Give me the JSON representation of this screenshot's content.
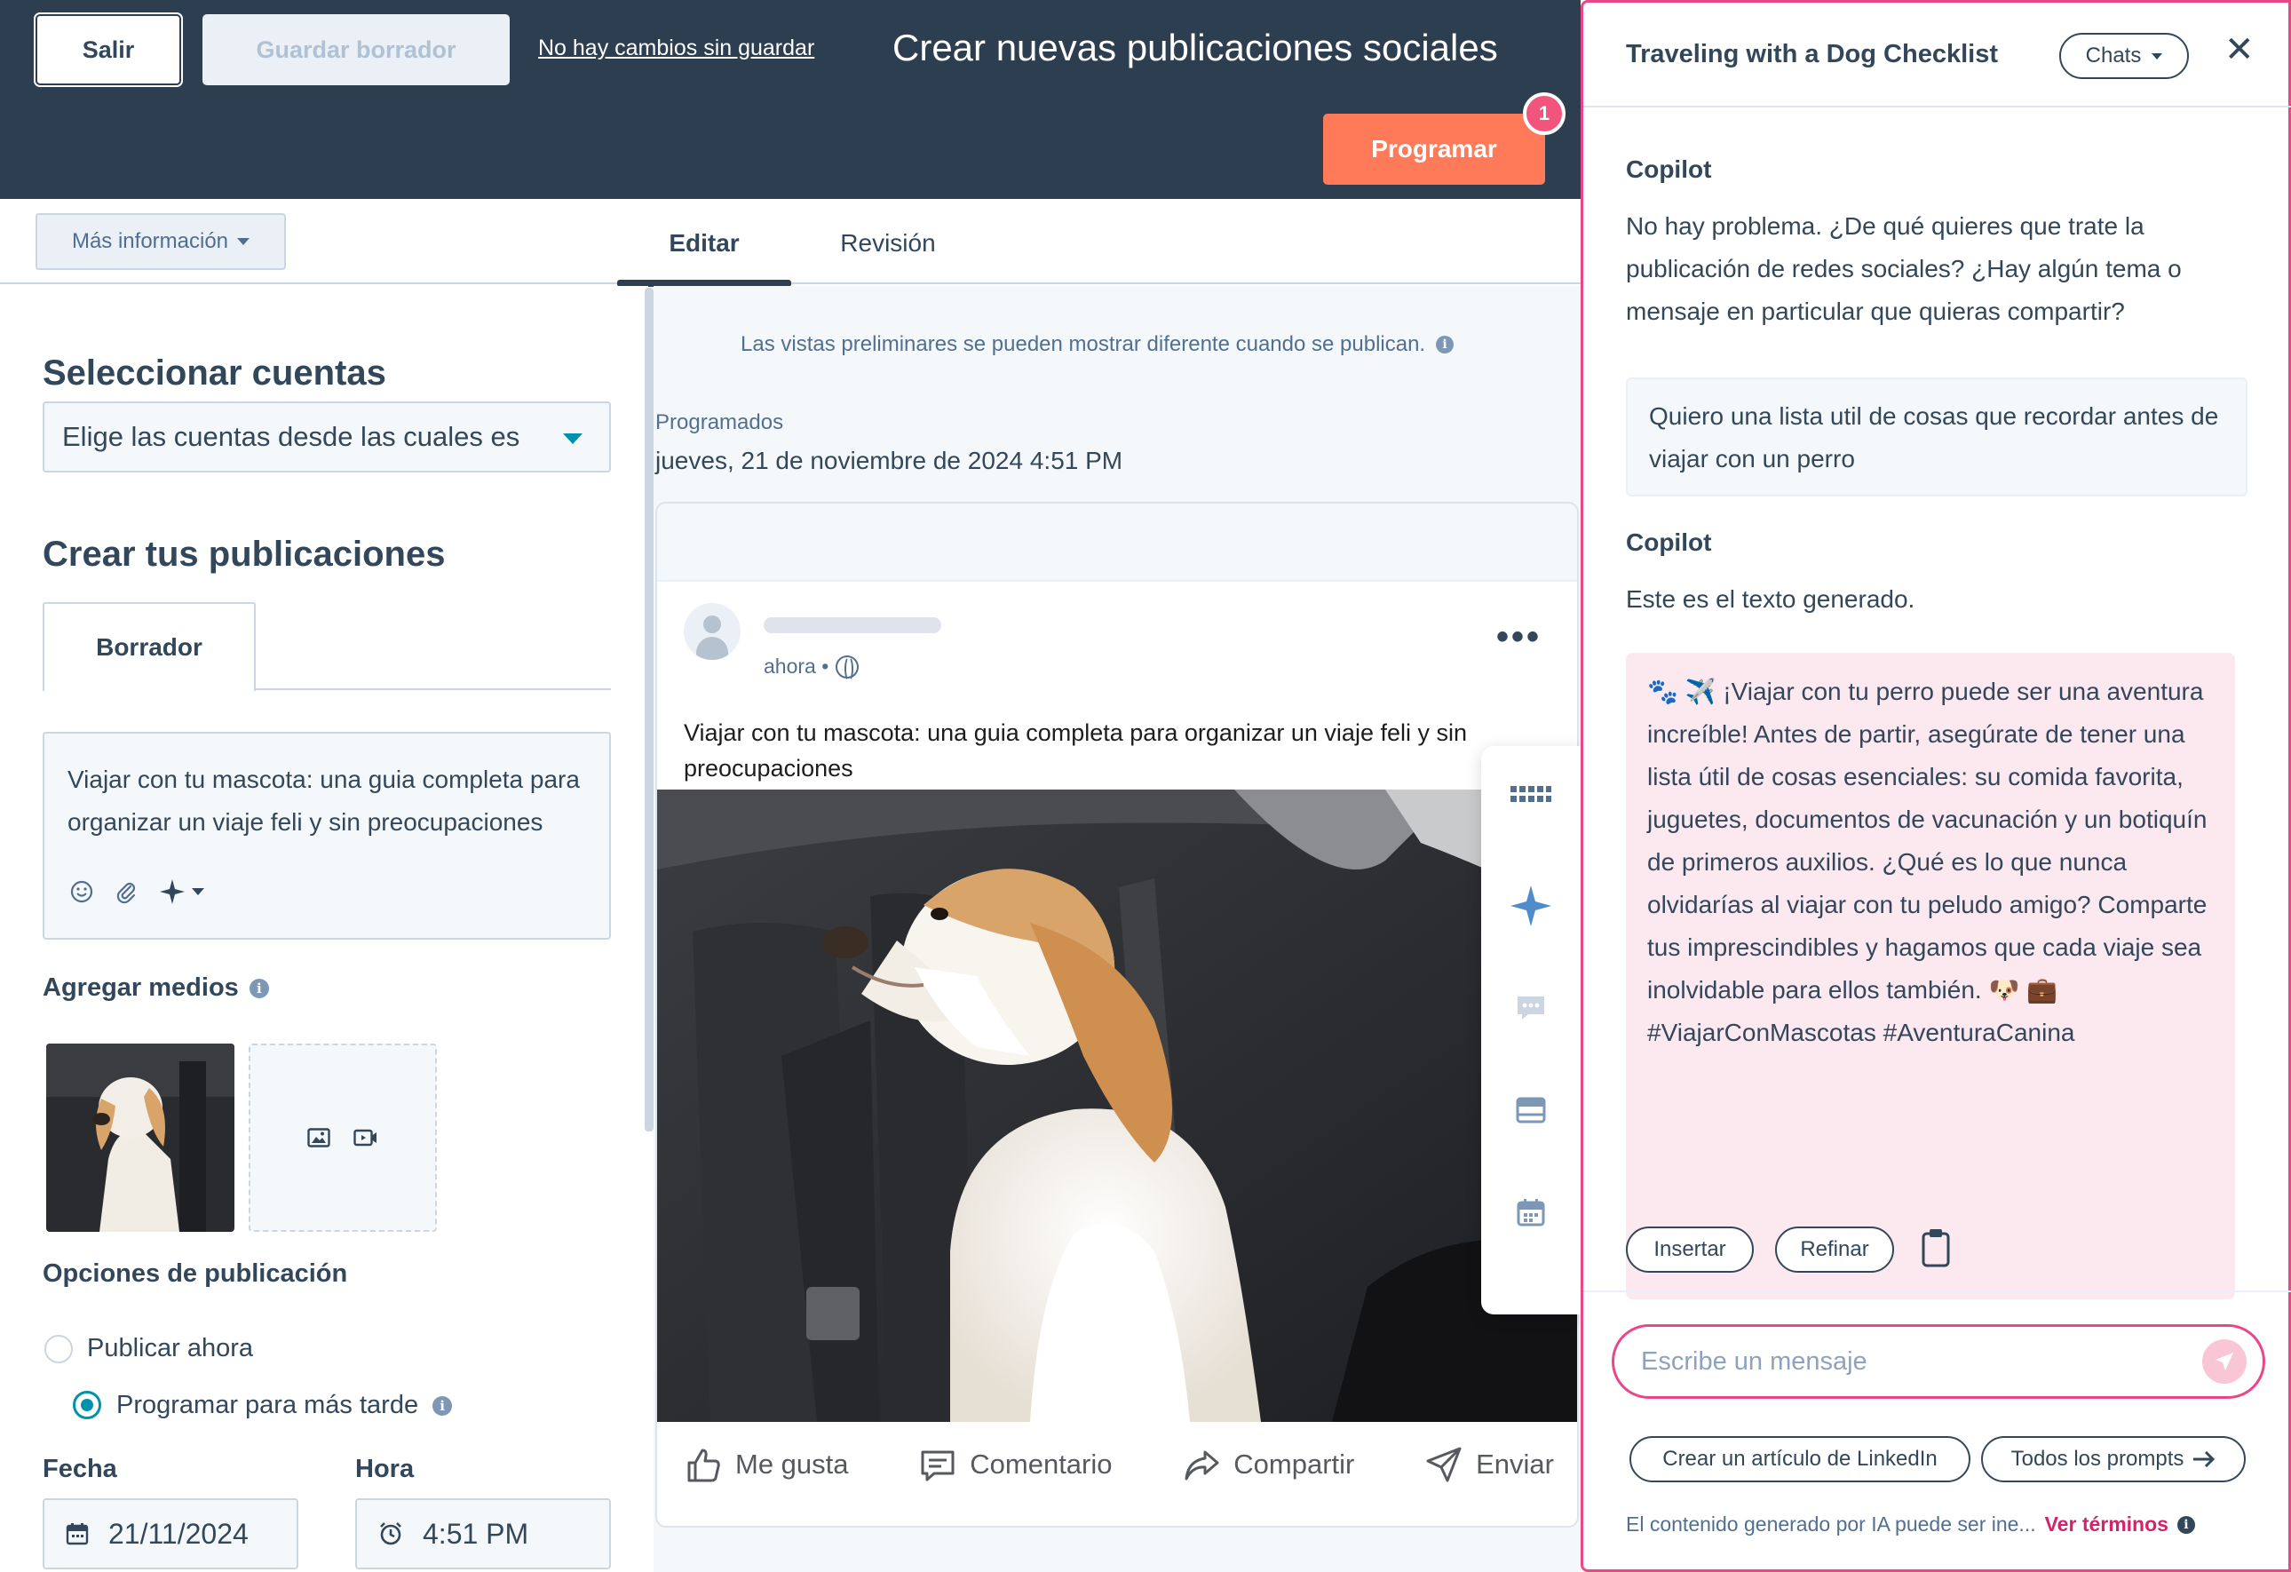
{
  "header": {
    "exit_label": "Salir",
    "save_draft_label": "Guardar borrador",
    "unsaved_status": "No hay cambios sin guardar",
    "title": "Crear nuevas publicaciones sociales",
    "schedule_label": "Programar",
    "schedule_badge": "1"
  },
  "tabs": {
    "more_info_label": "Más información",
    "edit_label": "Editar",
    "review_label": "Revisión"
  },
  "left": {
    "select_accounts_title": "Seleccionar cuentas",
    "accounts_placeholder": "Elige las cuentas desde las cuales es",
    "create_posts_title": "Crear tus publicaciones",
    "draft_tab_label": "Borrador",
    "draft_text": "Viajar con tu mascota: una guia completa para organizar un viaje feli y sin preocupaciones",
    "add_media_label": "Agregar medios",
    "publish_options_label": "Opciones de publicación",
    "publish_now_label": "Publicar ahora",
    "schedule_later_label": "Programar para más tarde",
    "selected_option": "Programar para más tarde",
    "date_label": "Fecha",
    "date_value": "21/11/2024",
    "time_label": "Hora",
    "time_value": "4:51 PM"
  },
  "preview": {
    "note": "Las vistas preliminares se pueden mostrar diferente cuando se publican.",
    "scheduled_label": "Programados",
    "scheduled_date": "jueves, 21 de noviembre de 2024 4:51 PM",
    "post_time": "ahora •",
    "post_text": "Viajar con tu mascota: una guia completa para organizar un viaje feli y sin preocupaciones",
    "actions": {
      "like": "Me gusta",
      "comment": "Comentario",
      "share": "Compartir",
      "send": "Enviar"
    }
  },
  "chat": {
    "title": "Traveling with a Dog Checklist",
    "chats_label": "Chats",
    "speaker_bot": "Copilot",
    "bot_message_1": "No hay problema. ¿De qué quieres que trate la publicación de redes sociales? ¿Hay algún tema o mensaje en particular que quieras compartir?",
    "user_message": "Quiero una lista util de cosas que recordar antes de viajar con un perro",
    "bot_message_2": "Este es el texto generado.",
    "generated_text": "🐾 ✈️ ¡Viajar con tu perro puede ser una aventura increíble! Antes de partir, asegúrate de tener una lista útil de cosas esenciales: su comida favorita, juguetes, documentos de vacunación y un botiquín de primeros auxilios. ¿Qué es lo que nunca olvidarías al viajar con tu peludo amigo? Comparte tus imprescindibles y hagamos que cada viaje sea inolvidable para ellos también. 🐶 💼 #ViajarConMascotas #AventuraCanina",
    "insert_label": "Insertar",
    "refine_label": "Refinar",
    "input_placeholder": "Escribe un mensaje",
    "suggestion_linkedin": "Crear un artículo de LinkedIn",
    "suggestion_all_prompts": "Todos los prompts",
    "disclaimer": "El contenido generado por IA puede ser ine...",
    "terms_link": "Ver términos"
  },
  "colors": {
    "header_bg": "#2d3e50",
    "primary_orange": "#ff7a59",
    "copilot_accent": "#e8488a",
    "generated_bubble": "#fce8ef",
    "teal": "#0091ae"
  }
}
